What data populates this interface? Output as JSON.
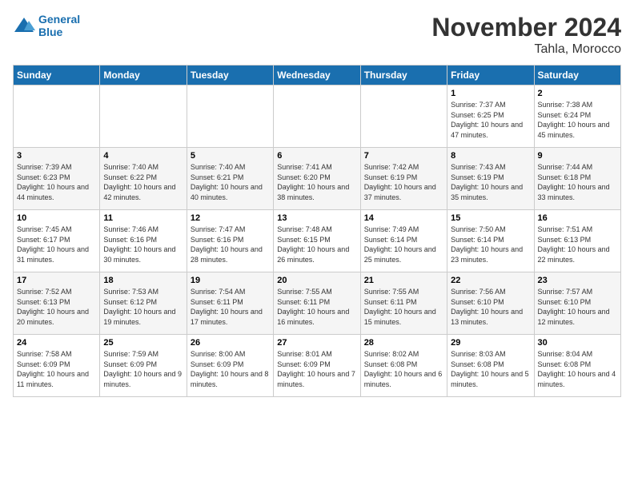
{
  "header": {
    "logo_line1": "General",
    "logo_line2": "Blue",
    "month_title": "November 2024",
    "location": "Tahla, Morocco"
  },
  "weekdays": [
    "Sunday",
    "Monday",
    "Tuesday",
    "Wednesday",
    "Thursday",
    "Friday",
    "Saturday"
  ],
  "weeks": [
    [
      {
        "day": "",
        "info": ""
      },
      {
        "day": "",
        "info": ""
      },
      {
        "day": "",
        "info": ""
      },
      {
        "day": "",
        "info": ""
      },
      {
        "day": "",
        "info": ""
      },
      {
        "day": "1",
        "info": "Sunrise: 7:37 AM\nSunset: 6:25 PM\nDaylight: 10 hours and 47 minutes."
      },
      {
        "day": "2",
        "info": "Sunrise: 7:38 AM\nSunset: 6:24 PM\nDaylight: 10 hours and 45 minutes."
      }
    ],
    [
      {
        "day": "3",
        "info": "Sunrise: 7:39 AM\nSunset: 6:23 PM\nDaylight: 10 hours and 44 minutes."
      },
      {
        "day": "4",
        "info": "Sunrise: 7:40 AM\nSunset: 6:22 PM\nDaylight: 10 hours and 42 minutes."
      },
      {
        "day": "5",
        "info": "Sunrise: 7:40 AM\nSunset: 6:21 PM\nDaylight: 10 hours and 40 minutes."
      },
      {
        "day": "6",
        "info": "Sunrise: 7:41 AM\nSunset: 6:20 PM\nDaylight: 10 hours and 38 minutes."
      },
      {
        "day": "7",
        "info": "Sunrise: 7:42 AM\nSunset: 6:19 PM\nDaylight: 10 hours and 37 minutes."
      },
      {
        "day": "8",
        "info": "Sunrise: 7:43 AM\nSunset: 6:19 PM\nDaylight: 10 hours and 35 minutes."
      },
      {
        "day": "9",
        "info": "Sunrise: 7:44 AM\nSunset: 6:18 PM\nDaylight: 10 hours and 33 minutes."
      }
    ],
    [
      {
        "day": "10",
        "info": "Sunrise: 7:45 AM\nSunset: 6:17 PM\nDaylight: 10 hours and 31 minutes."
      },
      {
        "day": "11",
        "info": "Sunrise: 7:46 AM\nSunset: 6:16 PM\nDaylight: 10 hours and 30 minutes."
      },
      {
        "day": "12",
        "info": "Sunrise: 7:47 AM\nSunset: 6:16 PM\nDaylight: 10 hours and 28 minutes."
      },
      {
        "day": "13",
        "info": "Sunrise: 7:48 AM\nSunset: 6:15 PM\nDaylight: 10 hours and 26 minutes."
      },
      {
        "day": "14",
        "info": "Sunrise: 7:49 AM\nSunset: 6:14 PM\nDaylight: 10 hours and 25 minutes."
      },
      {
        "day": "15",
        "info": "Sunrise: 7:50 AM\nSunset: 6:14 PM\nDaylight: 10 hours and 23 minutes."
      },
      {
        "day": "16",
        "info": "Sunrise: 7:51 AM\nSunset: 6:13 PM\nDaylight: 10 hours and 22 minutes."
      }
    ],
    [
      {
        "day": "17",
        "info": "Sunrise: 7:52 AM\nSunset: 6:13 PM\nDaylight: 10 hours and 20 minutes."
      },
      {
        "day": "18",
        "info": "Sunrise: 7:53 AM\nSunset: 6:12 PM\nDaylight: 10 hours and 19 minutes."
      },
      {
        "day": "19",
        "info": "Sunrise: 7:54 AM\nSunset: 6:11 PM\nDaylight: 10 hours and 17 minutes."
      },
      {
        "day": "20",
        "info": "Sunrise: 7:55 AM\nSunset: 6:11 PM\nDaylight: 10 hours and 16 minutes."
      },
      {
        "day": "21",
        "info": "Sunrise: 7:55 AM\nSunset: 6:11 PM\nDaylight: 10 hours and 15 minutes."
      },
      {
        "day": "22",
        "info": "Sunrise: 7:56 AM\nSunset: 6:10 PM\nDaylight: 10 hours and 13 minutes."
      },
      {
        "day": "23",
        "info": "Sunrise: 7:57 AM\nSunset: 6:10 PM\nDaylight: 10 hours and 12 minutes."
      }
    ],
    [
      {
        "day": "24",
        "info": "Sunrise: 7:58 AM\nSunset: 6:09 PM\nDaylight: 10 hours and 11 minutes."
      },
      {
        "day": "25",
        "info": "Sunrise: 7:59 AM\nSunset: 6:09 PM\nDaylight: 10 hours and 9 minutes."
      },
      {
        "day": "26",
        "info": "Sunrise: 8:00 AM\nSunset: 6:09 PM\nDaylight: 10 hours and 8 minutes."
      },
      {
        "day": "27",
        "info": "Sunrise: 8:01 AM\nSunset: 6:09 PM\nDaylight: 10 hours and 7 minutes."
      },
      {
        "day": "28",
        "info": "Sunrise: 8:02 AM\nSunset: 6:08 PM\nDaylight: 10 hours and 6 minutes."
      },
      {
        "day": "29",
        "info": "Sunrise: 8:03 AM\nSunset: 6:08 PM\nDaylight: 10 hours and 5 minutes."
      },
      {
        "day": "30",
        "info": "Sunrise: 8:04 AM\nSunset: 6:08 PM\nDaylight: 10 hours and 4 minutes."
      }
    ]
  ]
}
